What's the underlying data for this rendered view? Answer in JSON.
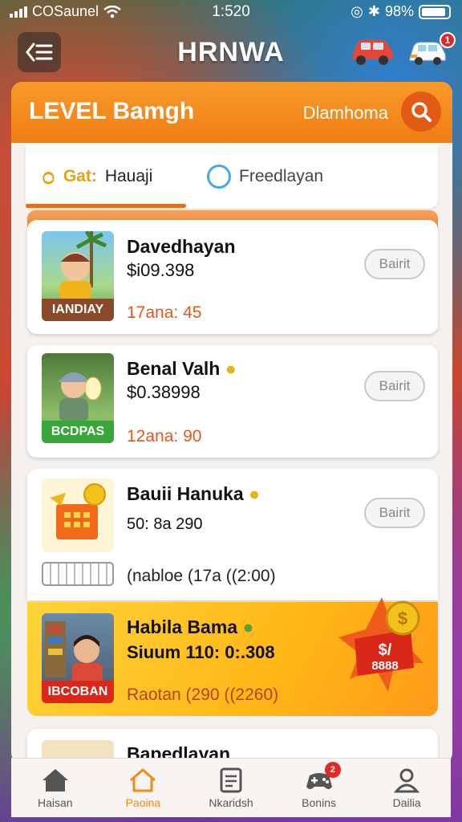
{
  "status": {
    "carrier": "COSaunel",
    "time": "1:520",
    "battery": "98%"
  },
  "header": {
    "back_icon": "back-list-icon",
    "title": "HRNWA",
    "notification_count": "1"
  },
  "level": {
    "title": "LEVEL Bamgh",
    "subtitle": "Dlamhoma"
  },
  "tabs": [
    {
      "prefix": "Gat:",
      "label": "Hauaji",
      "active": true
    },
    {
      "label": "Freedlayan",
      "active": false
    }
  ],
  "items": [
    {
      "name": "Davedhayan",
      "price": "$i09.398",
      "meta": "17ana: 45",
      "badge": "IANDIAY",
      "button": "Bairit"
    },
    {
      "name": "Benal Valh",
      "price": "$0.38998",
      "meta": "12ana: 90",
      "badge": "BCDPAS",
      "button": "Bairit"
    },
    {
      "name": "Bauii Hanuka",
      "price": "50: 8a 290",
      "meta": "(nabloe (17a ((2:00)",
      "button": "Bairit"
    },
    {
      "name": "Habila Bama",
      "price": "Siuum 110: 0:.308",
      "meta": "Raotan (290 ((2260)",
      "badge": "IBCOBAN"
    },
    {
      "name": "Bapedlayan"
    }
  ],
  "promo": {
    "badge_text": "8888",
    "badge_top": "$/"
  },
  "bottom_nav": [
    {
      "label": "Haisan",
      "icon": "home-icon",
      "active": false
    },
    {
      "label": "Paoina",
      "icon": "house-outline-icon",
      "active": true
    },
    {
      "label": "Nkaridsh",
      "icon": "document-icon",
      "active": false
    },
    {
      "label": "Bonins",
      "icon": "game-controller-icon",
      "active": false,
      "badge": "2"
    },
    {
      "label": "Dailia",
      "icon": "profile-icon",
      "active": false
    }
  ],
  "colors": {
    "accent": "#ef7d14",
    "price_meta": "#e2581a",
    "active_tab": "#e5701a"
  }
}
